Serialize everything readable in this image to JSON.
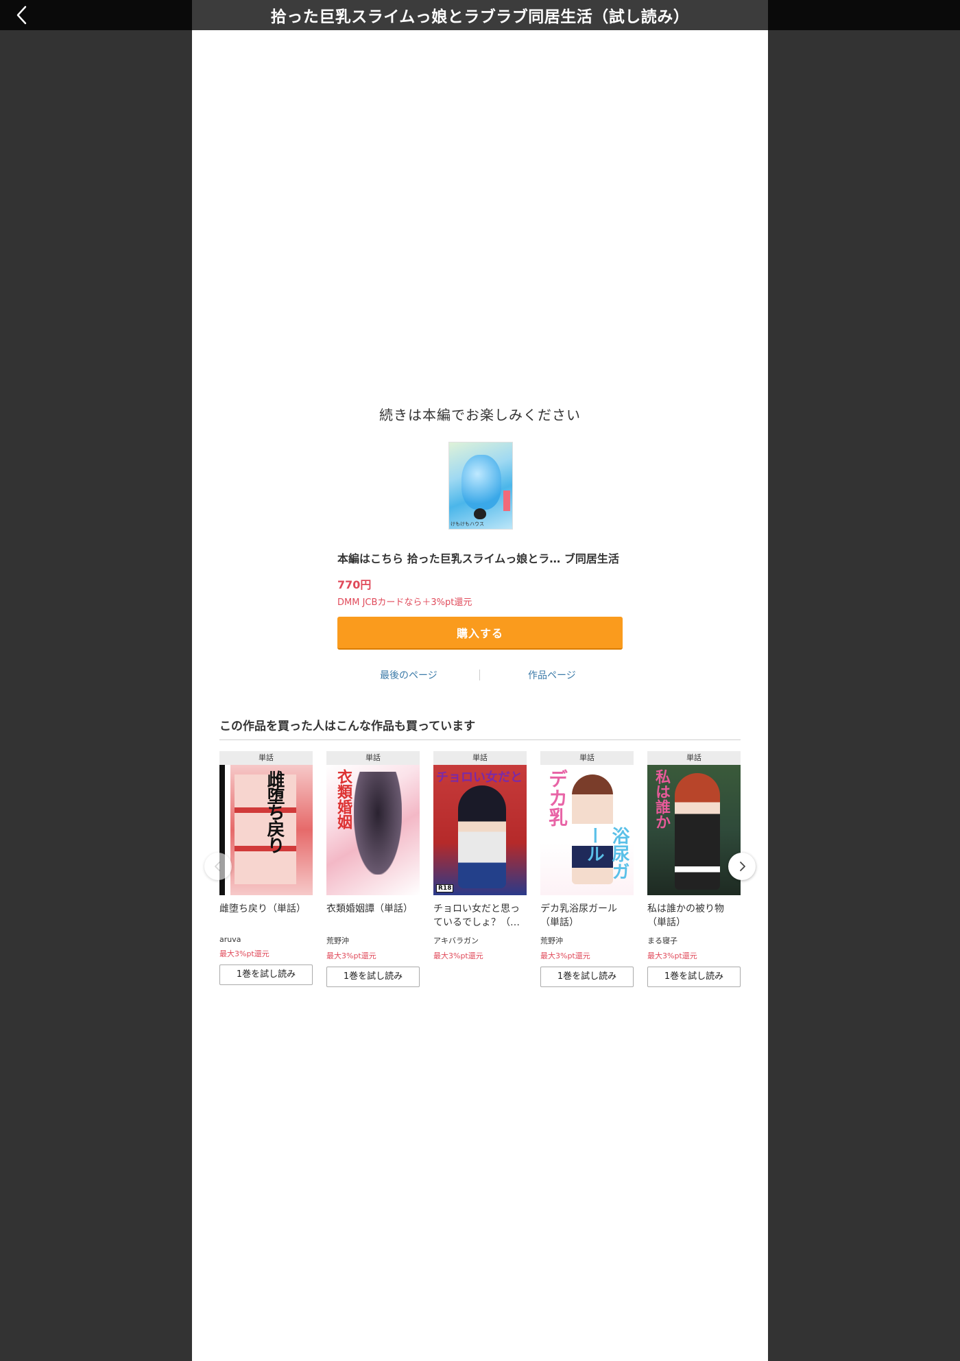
{
  "header": {
    "title": "拾った巨乳スライムっ娘とラブラブ同居生活（試し読み）"
  },
  "end_panel": {
    "continue_message": "続きは本編でお楽しみください",
    "cover_publisher": "けもけもハウス",
    "product_title": "本編はこちら  拾った巨乳スライムっ娘とラ… ブ同居生活",
    "price": "770円",
    "cashback": "DMM JCBカードなら＋3%pt還元",
    "buy_label": "購入する",
    "last_page_link": "最後のページ",
    "product_page_link": "作品ページ"
  },
  "recommendations": {
    "section_title": "この作品を買った人はこんな作品も買っています",
    "items": [
      {
        "badge": "単話",
        "cover_text": "雌堕ち戻り",
        "name": "雌堕ち戻り（単話）",
        "author": "aruva",
        "points": "最大3%pt還元",
        "trial": "1巻を試し読み"
      },
      {
        "badge": "単話",
        "cover_text": "衣類婚姻",
        "name": "衣類婚姻譚（単話）",
        "author": "荒野沖",
        "points": "最大3%pt還元",
        "trial": "1巻を試し読み"
      },
      {
        "badge": "単話",
        "cover_text": "チョロい女だと",
        "name": "チョロい女だと思っているでしょ？（…",
        "author": "アキバラガン",
        "points": "最大3%pt還元",
        "trial": ""
      },
      {
        "badge": "単話",
        "cover_text": "デカ乳",
        "cover_text2": "浴尿ガール",
        "name": "デカ乳浴尿ガール（単話）",
        "author": "荒野沖",
        "points": "最大3%pt還元",
        "trial": "1巻を試し読み"
      },
      {
        "badge": "単話",
        "cover_text": "私は誰か",
        "name": "私は誰かの被り物（単話）",
        "author": "まる寝子",
        "points": "最大3%pt還元",
        "trial": "1巻を試し読み"
      }
    ],
    "r18_label": "R18"
  }
}
